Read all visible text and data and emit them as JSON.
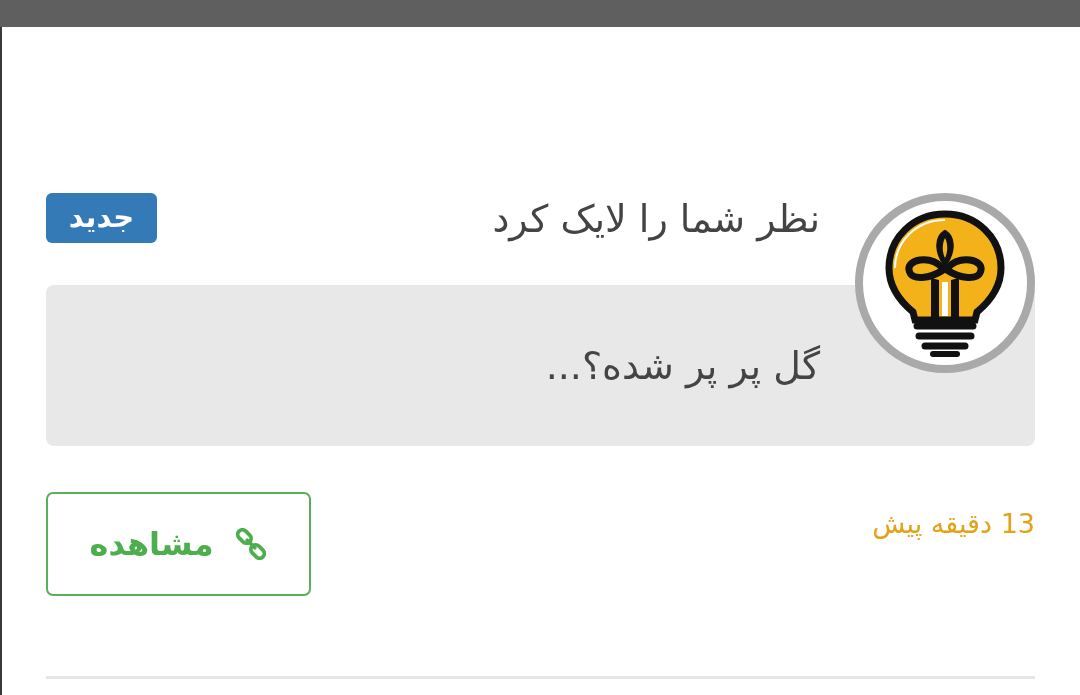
{
  "notification": {
    "title": "نظر شما را لایک کرد",
    "badge": "جدید",
    "comment": "گل پر پر شده؟...",
    "time": "13 دقیقه پیش",
    "view_button": "مشاهده"
  }
}
